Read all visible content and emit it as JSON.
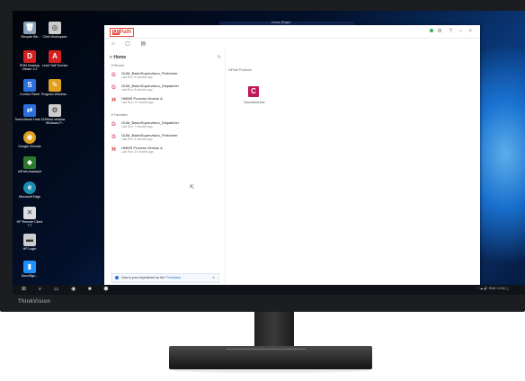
{
  "desktop_icons": [
    {
      "label": "Recycle Bin",
      "color": "#8aa0b8",
      "glyph": "🗑"
    },
    {
      "label": "Citrix Workspace",
      "color": "#cccccc",
      "glyph": "◎"
    },
    {
      "label": "RSM Desktop Viewer 3.2",
      "color": "#d42020",
      "glyph": "D"
    },
    {
      "label": "Level Self Service",
      "color": "#d42020",
      "glyph": "A"
    },
    {
      "label": "Control Panel",
      "color": "#2a6fdb",
      "glyph": "S"
    },
    {
      "label": "Program Window...",
      "color": "#e0a020",
      "glyph": "✎"
    },
    {
      "label": "TeamViewer Host 15",
      "color": "#2a6fdb",
      "glyph": "⇄"
    },
    {
      "label": "Reset window Windows P...",
      "color": "#cccccc",
      "glyph": "⚙"
    },
    {
      "label": "Google Chrome",
      "color": "#e0a020",
      "glyph": "◉"
    },
    {
      "label": "UiPath Assistant",
      "color": "#2a7a2a",
      "glyph": "◆"
    },
    {
      "label": "Microsoft Edge",
      "color": "#1b8fb0",
      "glyph": "e"
    },
    {
      "label": "HP Remote Client 7.7",
      "color": "#dddddd",
      "glyph": "✕"
    },
    {
      "label": "HP Login",
      "color": "#cccccc",
      "glyph": "▬"
    },
    {
      "label": "DocuSign...",
      "color": "#1e90ff",
      "glyph": "▮"
    }
  ],
  "window": {
    "logo_ui": "Ui",
    "logo_text": "Path",
    "title_center": "Home (Page)",
    "home_label": "Home",
    "refresh_icon": "↻",
    "recent_label": "Recent",
    "favorites_label": "Favorites",
    "recent_items": [
      {
        "icon": "G",
        "color": "#d04a7a",
        "name": "GUM_BatchSupervision_Performer",
        "sub": "Last Run: 5 minutes ago"
      },
      {
        "icon": "G",
        "color": "#d04a7a",
        "name": "GUM_BatchSupervision_Dispatcher",
        "sub": "Last Run: 5 minutes ago"
      },
      {
        "icon": "H",
        "color": "#c03030",
        "name": "HMMS Process Version A",
        "sub": "Last Run: 12 months ago"
      }
    ],
    "favorite_items": [
      {
        "icon": "G",
        "color": "#d04a7a",
        "name": "GUM_BatchSupervision_Dispatcher",
        "sub": "Last Run: 7 minutes ago"
      },
      {
        "icon": "G",
        "color": "#d04a7a",
        "name": "GUM_BatchSupervision_Performer",
        "sub": "Last Run: 8 minutes ago"
      },
      {
        "icon": "H",
        "color": "#c03030",
        "name": "HMMS Process Version A",
        "sub": "Last Run: 12 months ago"
      }
    ],
    "main_section_label": "UiPath Products",
    "tile_letter": "C",
    "tile_label": "Document.exe",
    "feedback_text": "How is your experience so far?",
    "feedback_link": "Feedback",
    "close_glyph": "✕",
    "search_placeholder": "Type here to search",
    "search_icon": "🔍"
  },
  "taskbar": {
    "left_icons": "⊞ ⌕ ▭ ◉ ■ ⬢",
    "tray_text": "^ ☁ 🔊 ENG 13:04 ▢"
  },
  "brand": "ThinkVision"
}
